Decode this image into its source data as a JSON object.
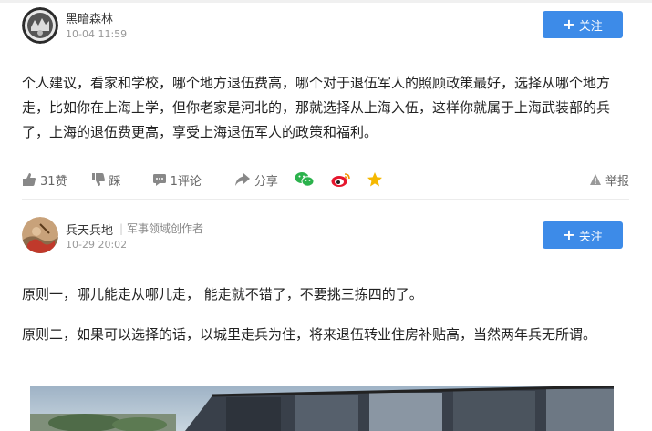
{
  "answers": [
    {
      "author": "黑暗森林",
      "datetime": "10-04 11:59",
      "follow_label": "关注",
      "content": [
        "个人建议，看家和学校，哪个地方退伍费高，哪个对于退伍军人的照顾政策最好，选择从哪个地方走，比如你在上海上学，但你老家是河北的，那就选择从上海入伍，这样你就属于上海武装部的兵了，上海的退伍费更高，享受上海退伍军人的政策和福利。"
      ],
      "actions": {
        "like": "31赞",
        "dislike": "踩",
        "comment": "1评论",
        "share": "分享",
        "report": "举报"
      }
    },
    {
      "author": "兵天兵地",
      "creator_tag": "军事领域创作者",
      "datetime": "10-29 20:02",
      "follow_label": "关注",
      "content": [
        "原则一，哪儿能走从哪儿走， 能走就不错了，不要挑三拣四的了。",
        "原则二，如果可以选择的话，以城里走兵为住，将来退伍转业住房补贴高，当然两年兵无所谓。"
      ]
    }
  ],
  "colors": {
    "follow_button": "#3d8be8",
    "wechat": "#2bb24c",
    "weibo": "#e6162d",
    "favorite": "#f5b800"
  },
  "icons": [
    "thumbs-up-icon",
    "thumbs-down-icon",
    "comment-icon",
    "share-icon",
    "wechat-icon",
    "weibo-icon",
    "star-icon",
    "report-icon",
    "plus-icon"
  ]
}
